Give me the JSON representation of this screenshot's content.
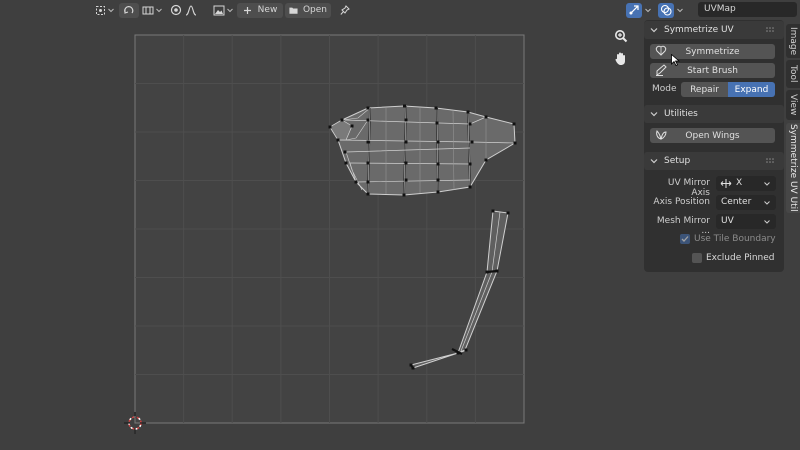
{
  "header": {
    "new_label": "New",
    "open_label": "Open",
    "uv_map_name": "UVMap"
  },
  "icons": {
    "pivot": "pivot-icon",
    "sync": "uv-sync-icon",
    "select_mode": "select-mode-icon",
    "proportional": "proportional-edit-icon",
    "falloff": "falloff-curve-icon",
    "image_browse": "image-browse-icon",
    "new": "plus-icon",
    "open": "folder-icon",
    "pin": "pin-icon",
    "gizmo": "gizmo-icon",
    "overlay": "overlay-icon",
    "zoom": "zoom-icon",
    "pan": "hand-icon",
    "cursor_2d": "2d-cursor-icon",
    "pointer": "mouse-pointer-icon"
  },
  "panel": {
    "symmetrize_section": {
      "title": "Symmetrize UV",
      "symmetrize_button": "Symmetrize",
      "start_brush_button": "Start Brush",
      "mode_label": "Mode",
      "mode_options": [
        "Repair",
        "Expand"
      ],
      "mode_selected": "Expand"
    },
    "utilities_section": {
      "title": "Utilities",
      "open_wings_button": "Open Wings"
    },
    "setup_section": {
      "title": "Setup",
      "uv_mirror_axis_label": "UV Mirror Axis",
      "uv_mirror_axis_value": "X",
      "axis_position_label": "Axis Position",
      "axis_position_value": "Center",
      "mesh_mirror_label": "Mesh Mirror ...",
      "mesh_mirror_value": "UV",
      "use_tile_boundary_label": "Use Tile Boundary",
      "use_tile_boundary_checked": true,
      "exclude_pinned_label": "Exclude Pinned",
      "exclude_pinned_checked": false
    }
  },
  "sidebar_tabs": [
    "Image",
    "Tool",
    "View",
    "Symmetrize UV Util"
  ],
  "sidebar_active_tab": "Symmetrize UV Util",
  "colors": {
    "accent": "#4772b3",
    "background": "#3f3f3f",
    "panel": "#303030",
    "uv_tile": "#434343"
  }
}
